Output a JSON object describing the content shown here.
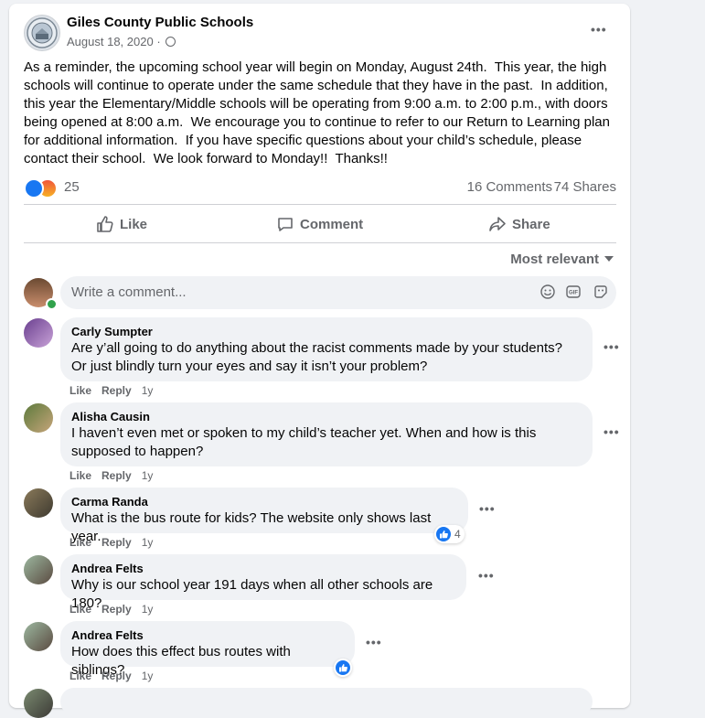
{
  "post": {
    "page_name": "Giles County Public Schools",
    "date": "August 18, 2020",
    "date_separator": "·",
    "more_icon": "•••",
    "text": "As a reminder, the upcoming school year will begin on Monday, August 24th.  This year, the high schools will continue to operate under the same schedule that they have in the past.  In addition, this year the Elementary/Middle schools will be operating from 9:00 a.m. to 2:00 p.m., with doors being opened at 8:00 a.m.  We encourage you to continue to refer to our Return to Learning plan for additional information.  If you have specific questions about your child’s schedule, please contact their school.  We look forward to Monday!!  Thanks!!",
    "reaction_count": "25",
    "comments_count": "16 Comments",
    "shares_count": "74 Shares",
    "colors": {
      "accent": "#1877f2",
      "muted": "#65676b",
      "bubble": "#f0f2f5"
    }
  },
  "actions": {
    "like": "Like",
    "comment": "Comment",
    "share": "Share"
  },
  "sort": {
    "label": "Most relevant"
  },
  "composer": {
    "placeholder": "Write a comment..."
  },
  "comment_actions": {
    "like": "Like",
    "reply": "Reply"
  },
  "comments": [
    {
      "author": "Carly Sumpter",
      "line1": "Are y’all going to do anything about the racist comments made by your students?",
      "line2": "Or just blindly turn your eyes and say it isn’t your problem?",
      "time": "1y"
    },
    {
      "author": "Alisha Causin",
      "line1": "I haven’t even met or spoken to my child’s teacher yet. When and how is this",
      "line2": "supposed to happen?",
      "time": "1y"
    },
    {
      "author": "Carma Randa",
      "line1": "What is the bus route for kids? The website only shows last year.",
      "time": "1y",
      "reaction_count": "4"
    },
    {
      "author": "Andrea Felts",
      "line1": "Why is our school year 191 days when all other schools are 180?",
      "time": "1y"
    },
    {
      "author": "Andrea Felts",
      "line1": "How does this effect bus routes with siblings?",
      "time": "1y"
    }
  ]
}
